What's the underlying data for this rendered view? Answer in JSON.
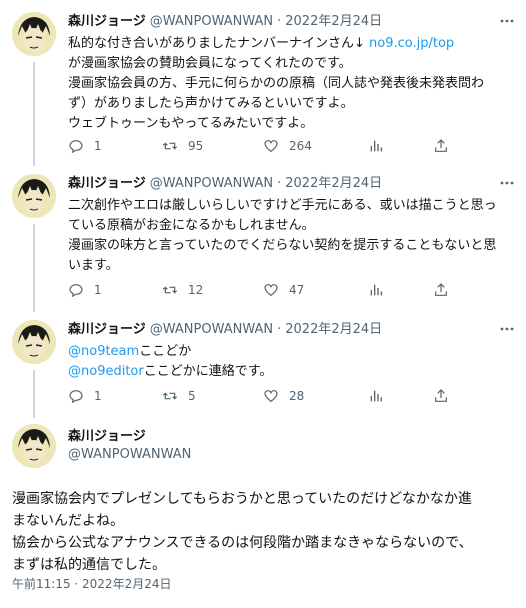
{
  "tweets": [
    {
      "name": "森川ジョージ",
      "handle": "@WANPOWANWAN",
      "sep": "·",
      "date": "2022年2月24日",
      "lines": [
        [
          "私的な付き合いがありましたナンバーナインさん↓ ",
          "no9.co.jp/top"
        ],
        [
          "が漫画家協会の賛助会員になってくれたのです。",
          ""
        ],
        [
          "漫画家協会員の方、手元に何らかのの原稿（同人誌や発表後未発表問わ",
          ""
        ],
        [
          "ず）がありましたら声かけてみるといいですよ。",
          ""
        ],
        [
          "ウェブトゥーンもやってるみたいですよ。",
          ""
        ]
      ],
      "replies": "1",
      "retweets": "95",
      "likes": "264"
    },
    {
      "name": "森川ジョージ",
      "handle": "@WANPOWANWAN",
      "sep": "·",
      "date": "2022年2月24日",
      "lines": [
        [
          "二次創作やエロは厳しいらしいですけど手元にある、或いは描こうと思っ",
          ""
        ],
        [
          "ている原稿がお金になるかもしれません。",
          ""
        ],
        [
          "漫画家の味方と言っていたのでくだらない契約を提示することもないと思",
          ""
        ],
        [
          "います。",
          ""
        ]
      ],
      "replies": "1",
      "retweets": "12",
      "likes": "47"
    },
    {
      "name": "森川ジョージ",
      "handle": "@WANPOWANWAN",
      "sep": "·",
      "date": "2022年2月24日",
      "lines": [
        [
          "",
          "@no9team",
          "ここどか"
        ],
        [
          "",
          "@no9editor",
          "ここどかに連絡です。"
        ]
      ],
      "replies": "1",
      "retweets": "5",
      "likes": "28"
    }
  ],
  "main": {
    "name": "森川ジョージ",
    "handle": "@WANPOWANWAN",
    "lines": [
      "漫画家協会内でプレゼンしてもらおうかと思っていたのだけどなかなか進",
      "まないんだよね。",
      "協会から公式なアナウンスできるのは何段階か踏まなきゃならないので、",
      "まずは私的通信でした。"
    ],
    "timestamp": "午前11:15 · 2022年2月24日"
  },
  "icons": {
    "reply": "comment-icon",
    "retweet": "retweet-icon",
    "like": "heart-icon",
    "views": "analytics-icon",
    "share": "share-icon",
    "more": "more-icon"
  },
  "colors": {
    "link": "#1d9bf0",
    "secondary": "#536471",
    "text": "#0f1419"
  }
}
